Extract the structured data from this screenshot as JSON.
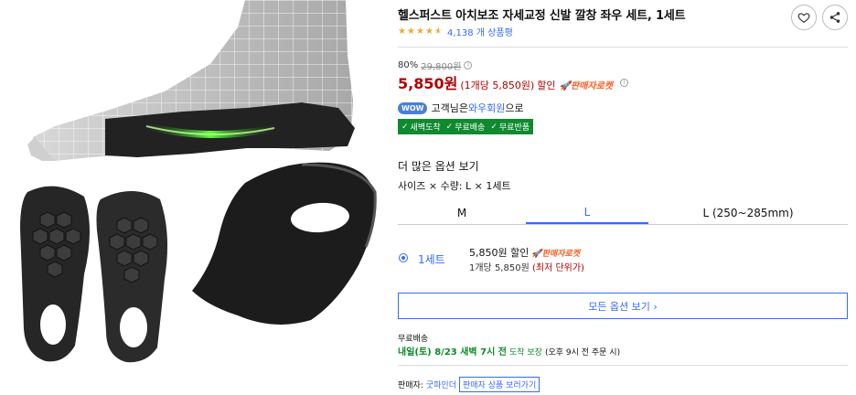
{
  "product": {
    "title": "헬스퍼스트 아치보조 자세교정 신발 깔창 좌우 세트, 1세트",
    "rating": 4.5,
    "review_count": "4,138 개 상품평"
  },
  "pricing": {
    "discount_rate": "80%",
    "original_price": "29,800원",
    "sale_price": "5,850원",
    "unit_price": "(1개당 5,850원)",
    "sale_label": "할인",
    "rocket_label": "판매자로켓"
  },
  "wow": {
    "badge": "WOW",
    "text_prefix": "고객님은 ",
    "link": "와우회원",
    "text_suffix": "으로"
  },
  "benefit_badges": [
    "새벽도착",
    "무료배송",
    "무료반품"
  ],
  "options": {
    "more_options_title": "더 많은 옵션 보기",
    "summary": "사이즈 × 수량: L × 1세트",
    "size_tabs": [
      "M",
      "L",
      "L (250~285mm)"
    ],
    "selected_size": "L",
    "quantity_option": {
      "label": "1세트",
      "price": "5,850원 할인",
      "rocket_label": "판매자로켓",
      "unit_price": "1개당 5,850원",
      "lowest_unit": "(최저 단위가)"
    },
    "all_options_button": "모든 옵션 보기 ›"
  },
  "shipping": {
    "label": "무료배송",
    "date": "내일(토) 8/23 새벽 7시 전",
    "guarantee": "도착 보장",
    "note": "(오후 9시 전 주문 시)"
  },
  "seller": {
    "label": "판매자:",
    "name": "굿파인더",
    "button": "판매자 상품 보러가기"
  },
  "colors": {
    "accent": "#346aff",
    "price_red": "#ae0000",
    "rocket_orange": "#ff5a1f",
    "badge_green": "#0f8a2f",
    "star": "#f4a62a"
  },
  "icons": [
    "heart-icon",
    "share-icon",
    "info-icon",
    "check-icon",
    "rocket-icon"
  ]
}
